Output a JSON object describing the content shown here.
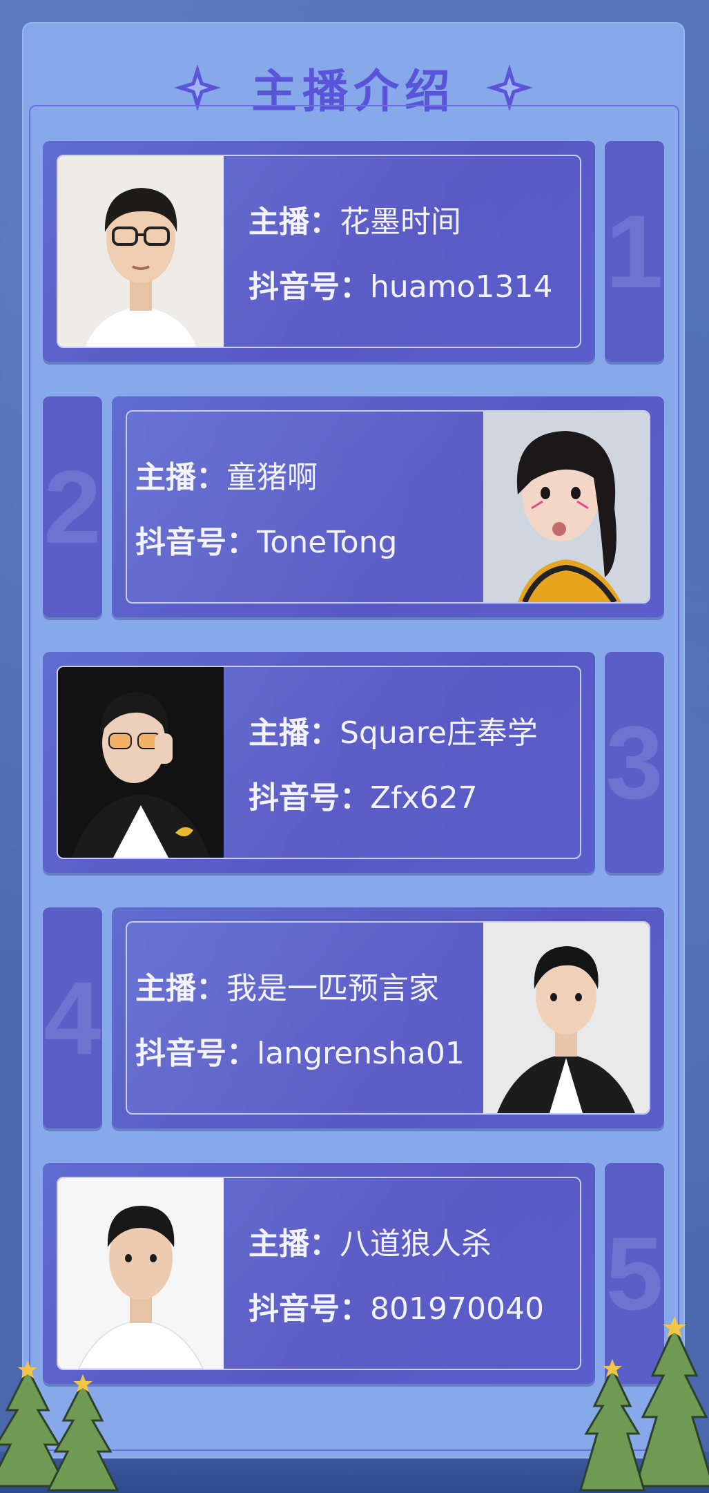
{
  "title": "主播介绍",
  "colors": {
    "background": "#4f6fb5",
    "panel": "#87a9e9",
    "title": "#5a55d8",
    "card": "#5a5fc8"
  },
  "decorations": [
    "sparkle-icon",
    "christmas-tree"
  ],
  "streamers": [
    {
      "number": "1",
      "host_label": "主播：",
      "host_name": "花墨时间",
      "id_label": "抖音号：",
      "douyin_id": "huamo1314"
    },
    {
      "number": "2",
      "host_label": "主播：",
      "host_name": "童猪啊",
      "id_label": "抖音号：",
      "douyin_id": "ToneTong"
    },
    {
      "number": "3",
      "host_label": "主播：",
      "host_name": "Square庄奉学",
      "id_label": "抖音号：",
      "douyin_id": "Zfx627"
    },
    {
      "number": "4",
      "host_label": "主播：",
      "host_name": "我是一匹预言家",
      "id_label": "抖音号：",
      "douyin_id": "langrensha01"
    },
    {
      "number": "5",
      "host_label": "主播：",
      "host_name": "八道狼人杀",
      "id_label": "抖音号：",
      "douyin_id": "801970040"
    }
  ]
}
